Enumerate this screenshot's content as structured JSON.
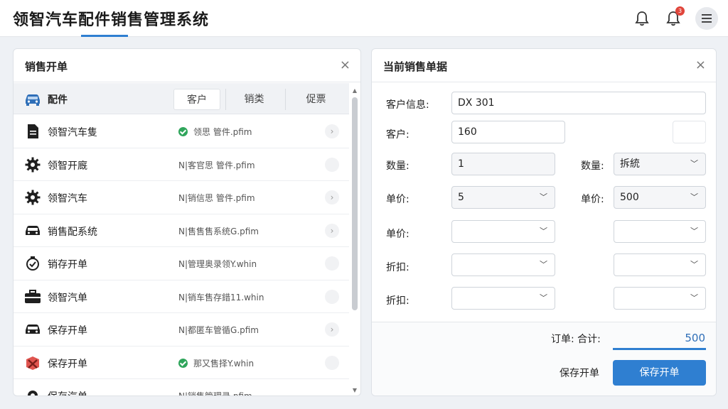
{
  "header": {
    "title": "领智汽车配件销售管理系统",
    "notification_count": "3"
  },
  "left_panel": {
    "title": "销售开单",
    "close": "×",
    "list_header": {
      "label": "配件",
      "tabs": [
        "客户",
        "销类",
        "促票"
      ]
    },
    "rows": [
      {
        "icon": "document-icon",
        "name": "领智汽车隻",
        "status": true,
        "desc": "领思  管件.pfim"
      },
      {
        "icon": "gear-icon",
        "name": "领智开廐",
        "status": false,
        "desc": "N|客官思  管件.pfim"
      },
      {
        "icon": "gear-icon",
        "name": "领智汽车",
        "status": false,
        "desc": "N|销信思  管件.pfim"
      },
      {
        "icon": "car-icon",
        "name": "销售配系统",
        "status": false,
        "desc": "N|售售售系统G.pfim"
      },
      {
        "icon": "clock-check-icon",
        "name": "销存开单",
        "status": false,
        "desc": "N|管理奥录领Y.whin"
      },
      {
        "icon": "toolbox-icon",
        "name": "领智汽单",
        "status": false,
        "desc": "N|销车售存錯11.whin"
      },
      {
        "icon": "car-icon",
        "name": "保存开单",
        "status": false,
        "desc": "N|都匿车管循G.pfim"
      },
      {
        "icon": "box-x-icon",
        "name": "保存开单",
        "status": true,
        "desc": "那又售择Y.whin"
      },
      {
        "icon": "gear-icon",
        "name": "保存汽单",
        "status": false,
        "desc": "N|销售管理录.pfim"
      }
    ]
  },
  "right_panel": {
    "title": "当前销售单据",
    "close": "×",
    "fields": {
      "customer_info_label": "客户信息:",
      "customer_info_value": "DX 301",
      "customer_label": "客户:",
      "customer_value": "160",
      "qty_label": "数量:",
      "qty_value": "1",
      "qty2_label": "数量:",
      "qty2_value": "拆統",
      "price_label": "单价:",
      "price_value": "5",
      "price2_label": "单价:",
      "price2_value": "500",
      "price3_label": "单价:",
      "discount_label": "折扣:",
      "discount2_label": "折扣:"
    },
    "total_label": "订单: 合计:",
    "total_value": "500",
    "secondary_button": "保存开单",
    "primary_button": "保存开单"
  }
}
